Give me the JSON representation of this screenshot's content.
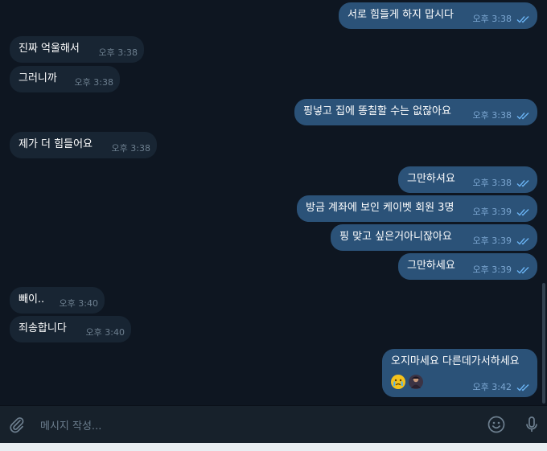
{
  "colors": {
    "background": "#0e1621",
    "incoming_bubble": "#182533",
    "outgoing_bubble": "#2b5278",
    "composer": "#17212b",
    "read_ticks": "#6ab3f3"
  },
  "messages": [
    {
      "direction": "out",
      "text": "서로 힘들게 하지 맙시다",
      "time": "오후 3:38",
      "read": true
    },
    {
      "direction": "in",
      "text": "진짜 억울해서",
      "time": "오후 3:38"
    },
    {
      "direction": "in",
      "text": "그러니까",
      "time": "오후 3:38"
    },
    {
      "direction": "out",
      "text": "핑넣고 집에 똥칠할 수는 없잖아요",
      "time": "오후 3:38",
      "read": true
    },
    {
      "direction": "in",
      "text": "제가 더 힘들어요",
      "time": "오후 3:38"
    },
    {
      "direction": "out",
      "text": "그만하셔요",
      "time": "오후 3:38",
      "read": true
    },
    {
      "direction": "out",
      "text": "방금 계좌에 보인 케이벳 회원 3명",
      "time": "오후 3:39",
      "read": true
    },
    {
      "direction": "out",
      "text": "핑 맞고 싶은거아니잖아요",
      "time": "오후 3:39",
      "read": true
    },
    {
      "direction": "out",
      "text": "그만하세요",
      "time": "오후 3:39",
      "read": true
    },
    {
      "direction": "in",
      "text": "빼이..",
      "time": "오후 3:40"
    },
    {
      "direction": "in",
      "text": "죄송합니다",
      "time": "오후 3:40"
    },
    {
      "direction": "out",
      "text": "오지마세요 다른데가서하세요",
      "time": "오후 3:42",
      "read": true,
      "emojis": [
        "crying-face-emoji",
        "person-emoji"
      ]
    }
  ],
  "composer": {
    "placeholder": "메시지 작성...",
    "icons": [
      "paperclip-icon",
      "smile-icon",
      "microphone-icon"
    ]
  }
}
